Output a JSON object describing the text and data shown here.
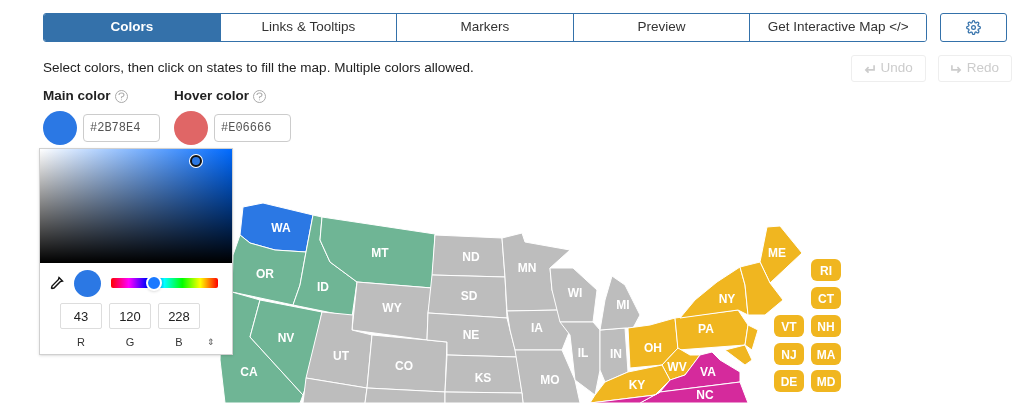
{
  "tabs": [
    {
      "label": "Colors",
      "selected": true
    },
    {
      "label": "Links & Tooltips",
      "selected": false
    },
    {
      "label": "Markers",
      "selected": false
    },
    {
      "label": "Preview",
      "selected": false
    },
    {
      "label": "Get Interactive Map </>",
      "selected": false
    }
  ],
  "instructions": "Select colors, then click on states to fill the map. Multiple colors allowed.",
  "history_buttons": [
    {
      "label": "Undo",
      "disabled": true
    },
    {
      "label": "Redo",
      "disabled": true
    }
  ],
  "main_color": {
    "label": "Main color",
    "value": "#2B78E4"
  },
  "hover_color": {
    "label": "Hover color",
    "value": "#E06666"
  },
  "picker": {
    "hue_slider": {
      "level": 0.4
    },
    "channels": [
      {
        "label": "R",
        "value": "43"
      },
      {
        "label": "G",
        "value": "120"
      },
      {
        "label": "B",
        "value": "228"
      }
    ],
    "mode_toggle": "⇕"
  },
  "states": [
    {
      "label": "WA",
      "color": "#2b78e4"
    },
    {
      "label": "OR",
      "color": "#6fb595"
    },
    {
      "label": "CA",
      "color": "#6fb595"
    },
    {
      "label": "NV",
      "color": "#6fb595"
    },
    {
      "label": "ID",
      "color": "#6fb595"
    },
    {
      "label": "MT",
      "color": "#6fb595"
    },
    {
      "label": "WY",
      "color": "#bdbdbd"
    },
    {
      "label": "UT",
      "color": "#bdbdbd"
    },
    {
      "label": "CO",
      "color": "#bdbdbd"
    },
    {
      "label": "ND",
      "color": "#bdbdbd"
    },
    {
      "label": "SD",
      "color": "#bdbdbd"
    },
    {
      "label": "NE",
      "color": "#bdbdbd"
    },
    {
      "label": "KS",
      "color": "#bdbdbd"
    },
    {
      "label": "MN",
      "color": "#bdbdbd"
    },
    {
      "label": "IA",
      "color": "#bdbdbd"
    },
    {
      "label": "MO",
      "color": "#bdbdbd"
    },
    {
      "label": "WI",
      "color": "#bdbdbd"
    },
    {
      "label": "IL",
      "color": "#bdbdbd"
    },
    {
      "label": "IN",
      "color": "#bdbdbd"
    },
    {
      "label": "MI",
      "color": "#bdbdbd"
    },
    {
      "label": "OH",
      "color": "#f0b620"
    },
    {
      "label": "PA",
      "color": "#f0b620"
    },
    {
      "label": "NY",
      "color": "#f0b620"
    },
    {
      "label": "ME",
      "color": "#f0b620"
    },
    {
      "label": "WV",
      "color": "#f0b620"
    },
    {
      "label": "KY",
      "color": "#f0b620"
    },
    {
      "label": "VA",
      "color": "#d52a9c"
    },
    {
      "label": "NC",
      "color": "#d52a9c"
    },
    {
      "color": "#f0b620"
    },
    {
      "color": "#f0b620"
    },
    {
      "color": "#f0b620"
    },
    {
      "color": "#d52a9c"
    },
    {
      "color": "#bdbdbd"
    },
    {
      "color": "#bdbdbd"
    },
    {
      "color": "#bdbdbd"
    }
  ],
  "small_states": [
    {
      "label": "RI",
      "color": "#f0b620"
    },
    {
      "label": "CT",
      "color": "#f0b620"
    },
    {
      "label": "VT",
      "color": "#f0b620"
    },
    {
      "label": "NH",
      "color": "#f0b620"
    },
    {
      "label": "NJ",
      "color": "#f0b620"
    },
    {
      "label": "MA",
      "color": "#f0b620"
    },
    {
      "label": "DE",
      "color": "#f0b620"
    },
    {
      "label": "MD",
      "color": "#f0b620"
    }
  ]
}
